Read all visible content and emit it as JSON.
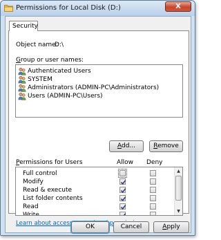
{
  "window": {
    "title": "Permissions for Local Disk (D:)",
    "close_glyph": "X"
  },
  "tab": {
    "label": "Security"
  },
  "object": {
    "label": "Object name:",
    "value": "D:\\"
  },
  "group": {
    "label_prefix": "G",
    "label_rest": "roup or user names:",
    "users": [
      "Authenticated Users",
      "SYSTEM",
      "Administrators (ADMIN-PC\\Administrators)",
      "Users (ADMIN-PC\\Users)"
    ]
  },
  "buttons": {
    "add_prefix": "A",
    "add_rest": "dd...",
    "remove_prefix": "R",
    "remove_rest": "emove",
    "ok": "OK",
    "cancel": "Cancel",
    "apply_prefix": "A",
    "apply_rest": "pply"
  },
  "permissions": {
    "header_prefix": "P",
    "header_rest": "ermissions for Users",
    "allow_header": "Allow",
    "deny_header": "Deny",
    "rows": [
      {
        "label": "Full control",
        "allow": false,
        "deny": false
      },
      {
        "label": "Modify",
        "allow": true,
        "deny": false
      },
      {
        "label": "Read & execute",
        "allow": true,
        "deny": false
      },
      {
        "label": "List folder contents",
        "allow": true,
        "deny": false
      },
      {
        "label": "Read",
        "allow": true,
        "deny": false
      },
      {
        "label": "Write",
        "allow": true,
        "deny": false
      }
    ]
  },
  "help_link": "Learn about access control and permissions",
  "icons": {
    "title": "folder-icon",
    "user": "users-group-icon"
  }
}
